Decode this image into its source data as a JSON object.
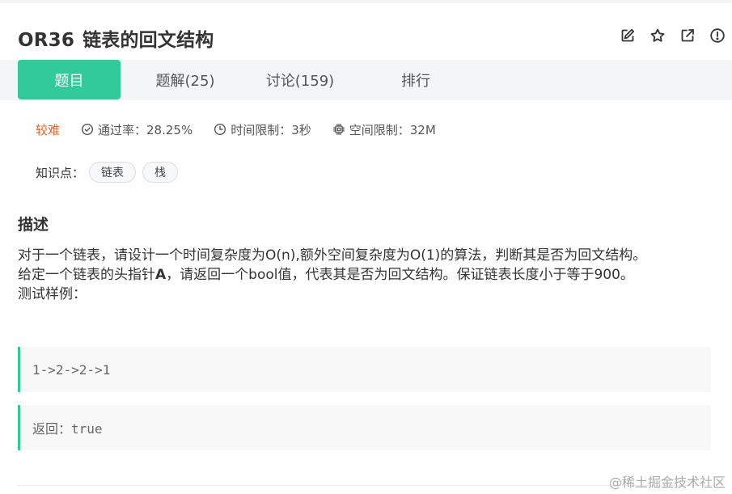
{
  "problem": {
    "id": "OR36",
    "title": "链表的回文结构"
  },
  "header_icons": [
    "edit-icon",
    "star-icon",
    "external-link-icon",
    "report-icon"
  ],
  "tabs": [
    {
      "label": "题目",
      "active": true
    },
    {
      "label": "题解(25)",
      "active": false
    },
    {
      "label": "讨论(159)",
      "active": false
    },
    {
      "label": "排行",
      "active": false
    }
  ],
  "meta": {
    "difficulty": "较难",
    "pass_rate": "通过率：28.25%",
    "time_limit": "时间限制：3秒",
    "space_limit": "空间限制：32M"
  },
  "knowledge": {
    "label": "知识点：",
    "tags": [
      "链表",
      "栈"
    ]
  },
  "description": {
    "heading": "描述",
    "line1": "对于一个链表，请设计一个时间复杂度为O(n),额外空间复杂度为O(1)的算法，判断其是否为回文结构。",
    "line2_pre": "给定一个链表的头指针",
    "line2_bold": "A",
    "line2_post": "，请返回一个bool值，代表其是否为回文结构。保证链表长度小于等于900。",
    "line3": "测试样例："
  },
  "samples": {
    "input": "1->2->2->1",
    "output": "返回：true"
  },
  "watermark": "@稀土掘金技术社区",
  "colors": {
    "accent": "#32ca99",
    "difficulty": "#e8642b",
    "tab_bar_bg": "#f4f5f7"
  }
}
